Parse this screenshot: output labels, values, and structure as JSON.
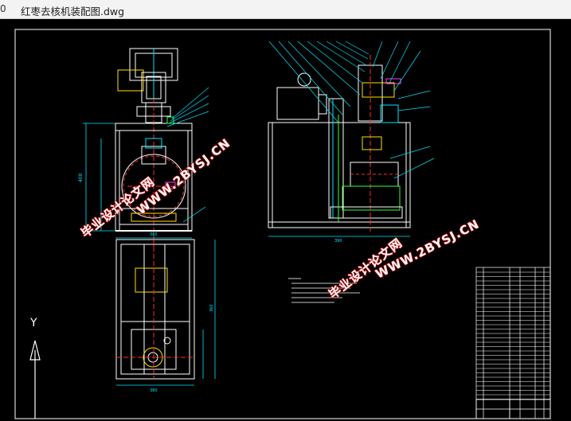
{
  "window": {
    "left_glyph": "0",
    "title": "红枣去核机装配图.dwg"
  },
  "watermarks": {
    "url": "WWW.2BYSJ.CN",
    "cn": "毕业设计论文网"
  },
  "drawing": {
    "dim_total_height": "400",
    "dim_total_width": "390",
    "dim_front_base": "380",
    "dim_top_width": "380",
    "dim_top_height": "360",
    "ucs_axis_label": "Y"
  },
  "colors": {
    "background": "#000000",
    "outline": "#ffffff",
    "dimension": "#00e5ff",
    "center_line": "#ff2a2a",
    "leader": "#00e5ff",
    "accent_yellow": "#ffe000",
    "accent_green": "#37ff37",
    "accent_magenta": "#ff3cff"
  }
}
